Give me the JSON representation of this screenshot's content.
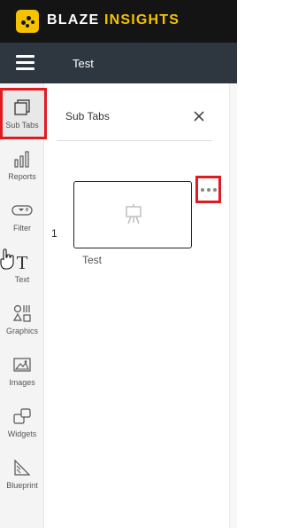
{
  "brand": {
    "name_part1": "BLAZE",
    "name_part2": "INSIGHTS",
    "accent_color": "#f5c200"
  },
  "navbar": {
    "title": "Test"
  },
  "sidebar": {
    "items": [
      {
        "label": "Sub Tabs",
        "icon": "sub-tabs-icon",
        "active": true
      },
      {
        "label": "Reports",
        "icon": "bar-chart-icon"
      },
      {
        "label": "Filter",
        "icon": "filter-icon"
      },
      {
        "label": "Text",
        "icon": "text-icon"
      },
      {
        "label": "Graphics",
        "icon": "shapes-icon"
      },
      {
        "label": "Images",
        "icon": "image-icon"
      },
      {
        "label": "Widgets",
        "icon": "widget-icon"
      },
      {
        "label": "Blueprint",
        "icon": "blueprint-icon"
      }
    ]
  },
  "panel": {
    "title": "Sub Tabs",
    "tabs": [
      {
        "index": "1",
        "label": "Test"
      }
    ]
  },
  "highlight_color": "#e01b22"
}
